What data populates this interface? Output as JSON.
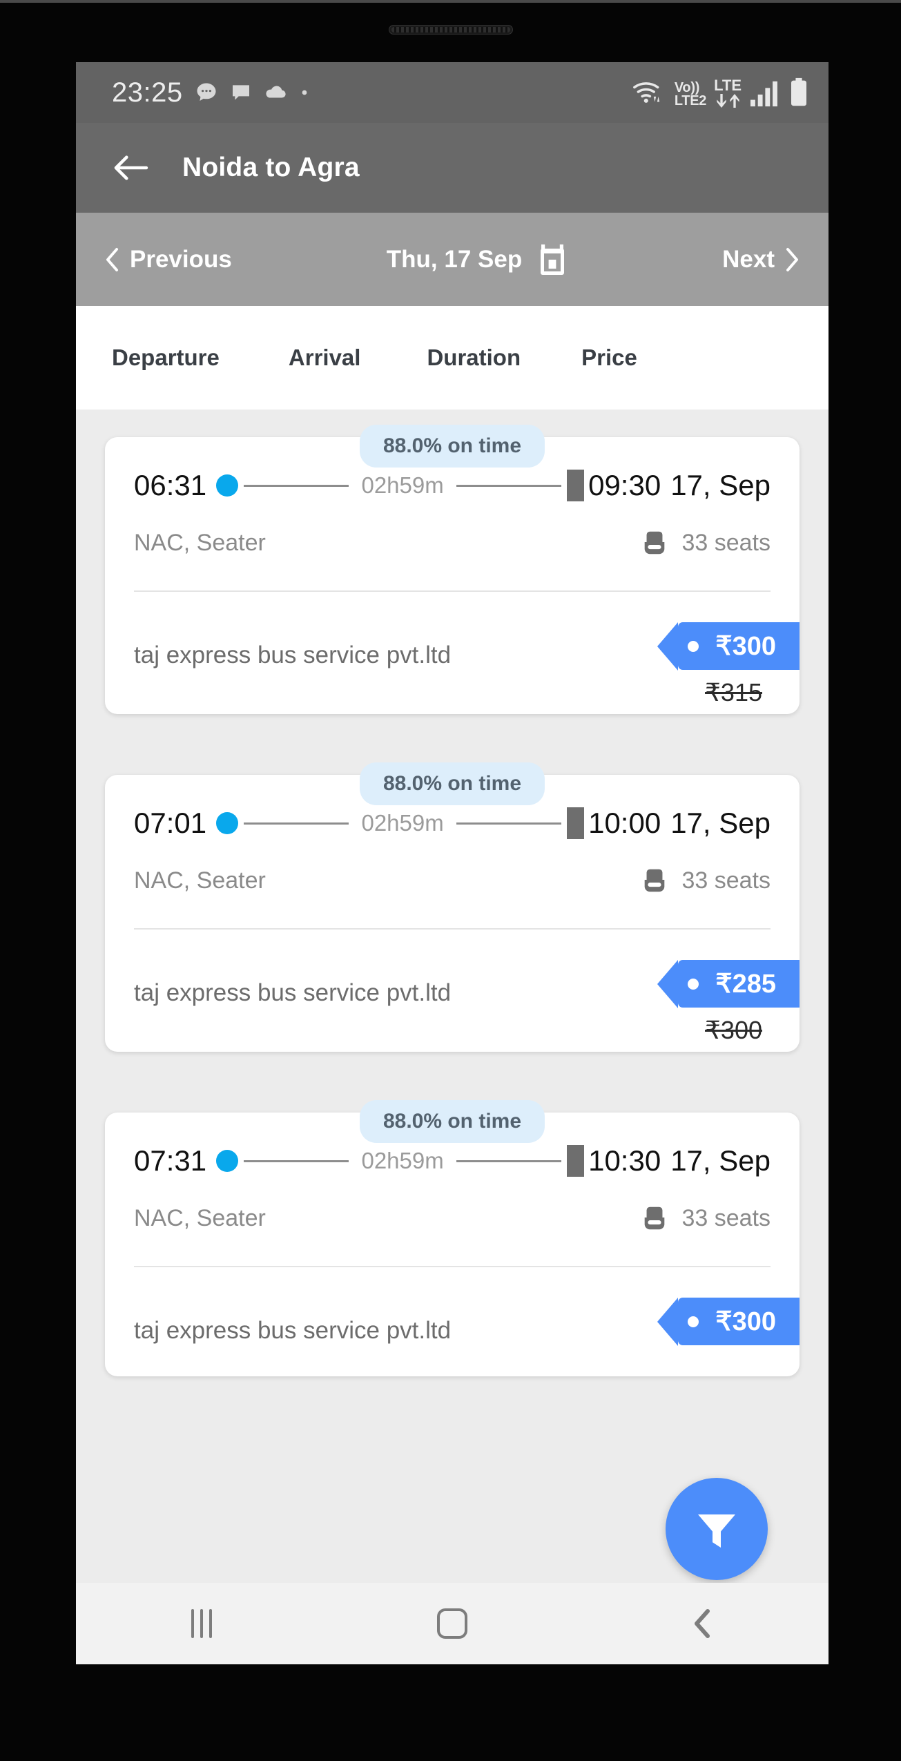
{
  "status_bar": {
    "time": "23:25",
    "icons_left": [
      "chat-dots-icon",
      "message-icon",
      "cloud-icon",
      "dot-icon"
    ],
    "volte_label": "Vo))",
    "sim_label": "LTE2",
    "network_label": "LTE",
    "icons_right": [
      "wifi-icon",
      "volte-icon",
      "lte-icon",
      "signal-bars-icon",
      "battery-icon"
    ]
  },
  "app_bar": {
    "back_icon": "arrow-left-icon",
    "title": "Noida to Agra"
  },
  "date_nav": {
    "previous_label": "Previous",
    "date_label": "Thu, 17 Sep",
    "next_label": "Next",
    "calendar_icon": "calendar-icon"
  },
  "sort_tabs": [
    {
      "label": "Departure"
    },
    {
      "label": "Arrival"
    },
    {
      "label": "Duration"
    },
    {
      "label": "Price"
    }
  ],
  "buses": [
    {
      "on_time": "88.0% on time",
      "departure_time": "06:31",
      "duration": "02h59m",
      "arrival_time": "09:30",
      "arrival_date": "17, Sep",
      "bus_type": "NAC, Seater",
      "seats": "33 seats",
      "operator": "taj express bus service pvt.ltd",
      "price": "₹300",
      "price_old": "₹315"
    },
    {
      "on_time": "88.0% on time",
      "departure_time": "07:01",
      "duration": "02h59m",
      "arrival_time": "10:00",
      "arrival_date": "17, Sep",
      "bus_type": "NAC, Seater",
      "seats": "33 seats",
      "operator": "taj express bus service pvt.ltd",
      "price": "₹285",
      "price_old": "₹300"
    },
    {
      "on_time": "88.0% on time",
      "departure_time": "07:31",
      "duration": "02h59m",
      "arrival_time": "10:30",
      "arrival_date": "17, Sep",
      "bus_type": "NAC, Seater",
      "seats": "33 seats",
      "operator": "taj express bus service pvt.ltd",
      "price": "₹300",
      "price_old": ""
    }
  ],
  "fab": {
    "icon": "filter-funnel-icon"
  },
  "nav_bar": {
    "recents_icon": "recents-icon",
    "home_icon": "home-icon",
    "back_icon": "back-chevron-icon"
  },
  "colors": {
    "accent_blue": "#4c8dfa",
    "origin_dot": "#09a8ec",
    "badge_bg": "#ddeefb",
    "app_bar": "#696969",
    "date_nav": "#9e9e9e",
    "page_bg": "#ececec"
  }
}
